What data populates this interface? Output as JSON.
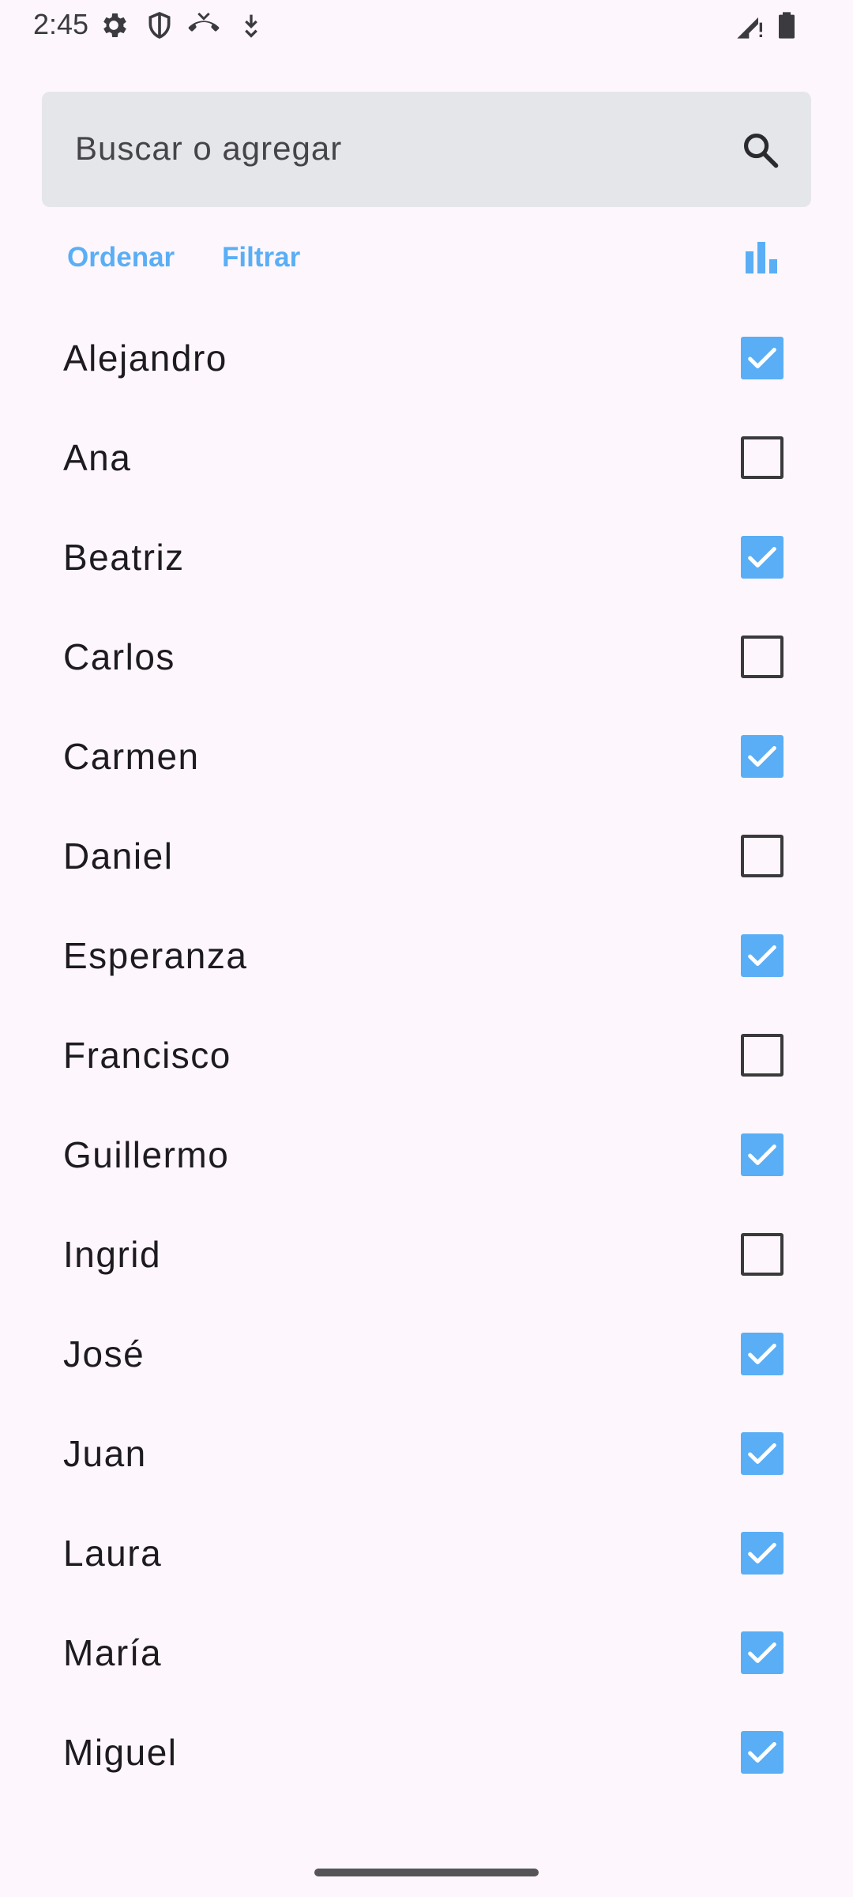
{
  "status_bar": {
    "time": "2:45",
    "icons": [
      "gear-icon",
      "shield-icon",
      "missed-call-icon",
      "download-icon",
      "signal-icon",
      "battery-icon"
    ]
  },
  "search": {
    "placeholder": "Buscar o agregar",
    "icon": "search-icon"
  },
  "toolbar": {
    "sort_label": "Ordenar",
    "filter_label": "Filtrar",
    "stats_icon": "bar-chart-icon"
  },
  "colors": {
    "accent": "#5aaef5",
    "background": "#fdf6fc",
    "search_bg": "#e5e6ea"
  },
  "items": [
    {
      "label": "Alejandro",
      "checked": true
    },
    {
      "label": "Ana",
      "checked": false
    },
    {
      "label": "Beatriz",
      "checked": true
    },
    {
      "label": "Carlos",
      "checked": false
    },
    {
      "label": "Carmen",
      "checked": true
    },
    {
      "label": "Daniel",
      "checked": false
    },
    {
      "label": "Esperanza",
      "checked": true
    },
    {
      "label": "Francisco",
      "checked": false
    },
    {
      "label": "Guillermo",
      "checked": true
    },
    {
      "label": "Ingrid",
      "checked": false
    },
    {
      "label": "José",
      "checked": true
    },
    {
      "label": "Juan",
      "checked": true
    },
    {
      "label": "Laura",
      "checked": true
    },
    {
      "label": "María",
      "checked": true
    },
    {
      "label": "Miguel",
      "checked": true
    }
  ]
}
